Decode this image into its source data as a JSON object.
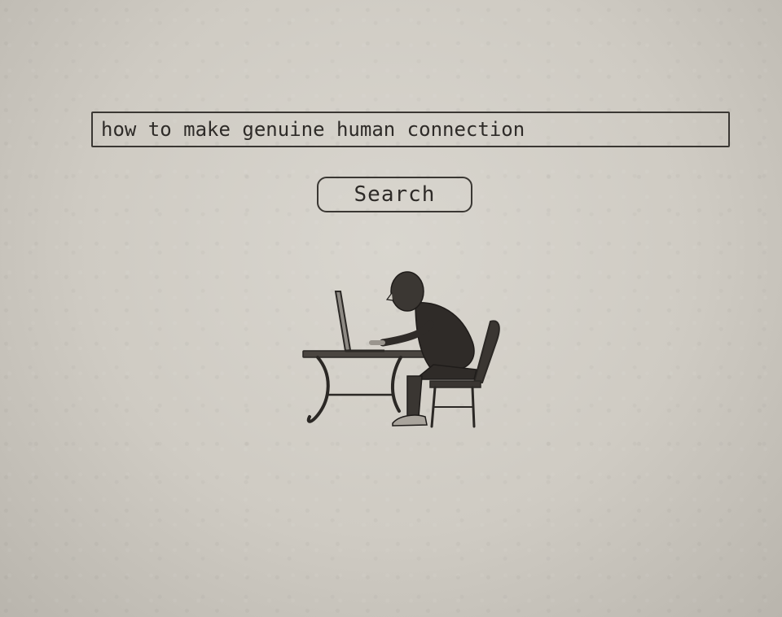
{
  "search": {
    "query": "how to make genuine human connection"
  },
  "button": {
    "label": "Search"
  },
  "illustration": {
    "subject": "person-at-laptop-icon"
  },
  "colors": {
    "paper": "#cfcbc3",
    "pencil": "#2e2b28"
  }
}
